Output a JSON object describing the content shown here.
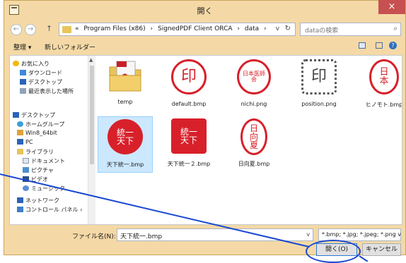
{
  "window": {
    "title": "開く",
    "close_glyph": "×"
  },
  "navigation": {
    "back_glyph": "←",
    "forward_glyph": "→",
    "up_glyph": "↑",
    "breadcrumbs": [
      "«",
      "Program Files (x86)",
      "›",
      "SignedPDF Client ORCA",
      "›",
      "data",
      "›"
    ],
    "dropdown_glyph": "v",
    "refresh_glyph": "↻",
    "search_placeholder": "dataの検索",
    "search_glyph": "⌕"
  },
  "commandbar": {
    "organize": "整理 ▾",
    "new_folder": "新しいフォルダー",
    "help_glyph": "?"
  },
  "sidebar": {
    "items": [
      {
        "label": "お気に入り",
        "icon": "star-icon"
      },
      {
        "label": "ダウンロード",
        "icon": "download-icon"
      },
      {
        "label": "デスクトップ",
        "icon": "desktop-icon"
      },
      {
        "label": "最近表示した場所",
        "icon": "recent-places-icon"
      },
      {
        "label": "デスクトップ",
        "icon": "desktop-icon"
      },
      {
        "label": "ホームグループ",
        "icon": "homegroup-icon"
      },
      {
        "label": "Win8_64bit",
        "icon": "user-icon"
      },
      {
        "label": "PC",
        "icon": "pc-icon"
      },
      {
        "label": "ライブラリ",
        "icon": "library-icon"
      },
      {
        "label": "ドキュメント",
        "icon": "documents-icon"
      },
      {
        "label": "ピクチャ",
        "icon": "pictures-icon"
      },
      {
        "label": "ビデオ",
        "icon": "video-icon"
      },
      {
        "label": "ミュージック",
        "icon": "music-icon"
      },
      {
        "label": "ネットワーク",
        "icon": "network-icon"
      },
      {
        "label": "コントロール パネル ›",
        "icon": "control-panel-icon"
      }
    ]
  },
  "files": [
    {
      "name": "temp",
      "type": "folder",
      "icon": "folder-pdf-icon"
    },
    {
      "name": "default.bmp",
      "type": "seal",
      "seal_text": "印"
    },
    {
      "name": "nichi.png",
      "type": "seal",
      "seal_text": "日本医師会"
    },
    {
      "name": "position.png",
      "type": "seal",
      "seal_text": "印"
    },
    {
      "name": "ヒノモト.bmp",
      "type": "seal",
      "seal_text": "日本"
    },
    {
      "name": "天下統一.bmp",
      "type": "seal",
      "seal_text": "統一天下",
      "selected": true
    },
    {
      "name": "天下統一２.bmp",
      "type": "seal",
      "seal_text": "統一天下"
    },
    {
      "name": "日向夏.bmp",
      "type": "seal",
      "seal_text": "日向夏"
    }
  ],
  "bottom": {
    "filename_label": "ファイル名(N):",
    "filename_value": "天下統一.bmp",
    "filename_dd": "v",
    "filter_value": "*.bmp; *.jpg; *.jpeg; *.png  v",
    "open_label": "開く(O)",
    "cancel_label": "キャンセル"
  },
  "colors": {
    "seal_red": "#d8202a",
    "annotation_blue": "#1a48d1",
    "window_frame": "#f4d9a6"
  }
}
